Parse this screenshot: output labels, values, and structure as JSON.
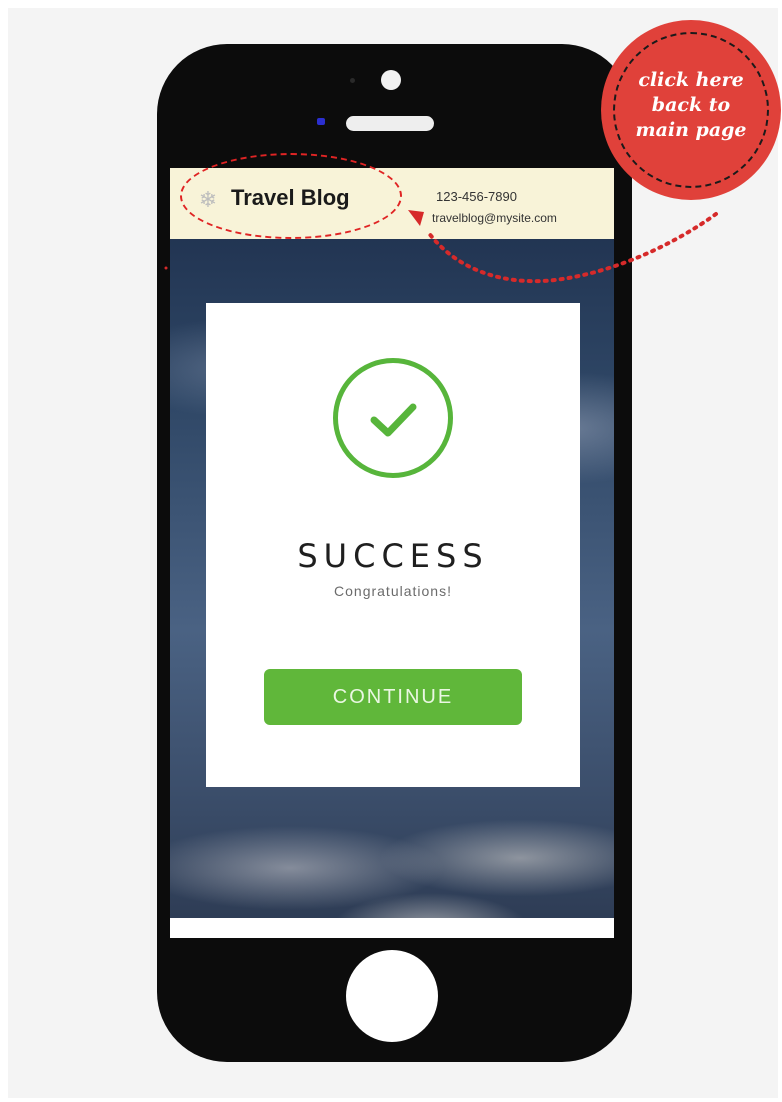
{
  "header": {
    "site_title": "Travel Blog",
    "phone": "123-456-7890",
    "email": "travelblog@mysite.com",
    "logo_icon": "snowflake-icon"
  },
  "annotation": {
    "lines": [
      "click here",
      "back to",
      "main page"
    ],
    "color": "#e0413a"
  },
  "card": {
    "icon": "checkmark-icon",
    "title": "SUCCESS",
    "subtitle": "Congratulations!",
    "button_label": "CONTINUE",
    "accent_color": "#5fb63a"
  }
}
